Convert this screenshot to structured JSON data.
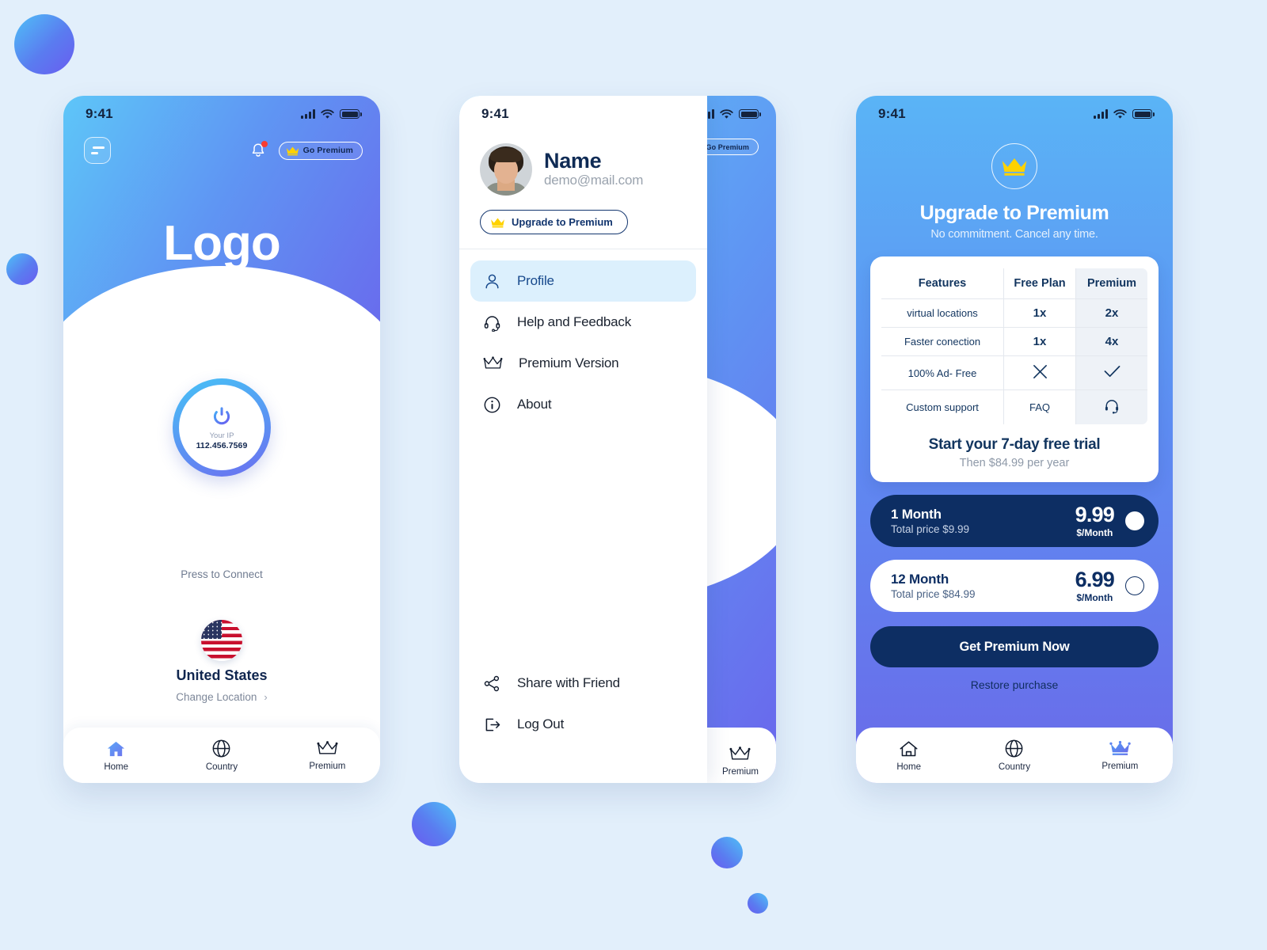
{
  "status_bar": {
    "time": "9:41"
  },
  "home_screen": {
    "menu_icon": "hamburger-menu-icon",
    "bell_icon": "notification-bell-icon",
    "go_premium_label": "Go Premium",
    "logo_text": "Logo",
    "connect": {
      "power_icon": "power-icon",
      "ip_label": "Your IP",
      "ip_value": "112.456.7569",
      "press_label": "Press to Connect"
    },
    "location": {
      "flag_icon": "united-states-flag-icon",
      "country": "United States",
      "change_label": "Change Location",
      "chevron": "›"
    },
    "tabs": [
      {
        "label": "Home",
        "icon": "home-icon",
        "active": true
      },
      {
        "label": "Country",
        "icon": "globe-icon",
        "active": false
      },
      {
        "label": "Premium",
        "icon": "crown-icon",
        "active": false
      }
    ]
  },
  "menu_screen": {
    "behind_go_premium_label": "Go Premium",
    "profile": {
      "avatar": "user-avatar",
      "name": "Name",
      "email": "demo@mail.com",
      "upgrade_label": "Upgrade to Premium",
      "crown_icon": "crown-icon"
    },
    "items": [
      {
        "label": "Profile",
        "icon": "person-icon",
        "selected": true
      },
      {
        "label": "Help and Feedback",
        "icon": "headset-icon",
        "selected": false
      },
      {
        "label": "Premium Version",
        "icon": "crown-icon",
        "selected": false
      },
      {
        "label": "About",
        "icon": "info-circle-icon",
        "selected": false
      }
    ],
    "bottom_items": [
      {
        "label": "Share with Friend",
        "icon": "share-icon"
      },
      {
        "label": "Log Out",
        "icon": "logout-icon"
      }
    ],
    "behind_tabs": [
      {
        "label": "Premium",
        "icon": "crown-icon"
      }
    ]
  },
  "premium_screen": {
    "crown_icon": "crown-icon",
    "title": "Upgrade to Premium",
    "subtitle": "No commitment. Cancel any time.",
    "table": {
      "headers": [
        "Features",
        "Free Plan",
        "Premium"
      ],
      "rows": [
        {
          "feature": "virtual locations",
          "free": "1x",
          "premium": "2x",
          "free_type": "text",
          "premium_type": "text"
        },
        {
          "feature": "Faster conection",
          "free": "1x",
          "premium": "4x",
          "free_type": "text",
          "premium_type": "text"
        },
        {
          "feature": "100% Ad- Free",
          "free": "",
          "premium": "",
          "free_type": "cross-icon",
          "premium_type": "check-icon"
        },
        {
          "feature": "Custom support",
          "free": "FAQ",
          "premium": "",
          "free_type": "text",
          "premium_type": "headset-icon"
        }
      ]
    },
    "trial_title": "Start your 7-day free trial",
    "trial_sub": "Then $84.99 per year",
    "plans": [
      {
        "title": "1 Month",
        "total": "Total price $9.99",
        "price": "9.99",
        "unit": "$/Month",
        "selected": true
      },
      {
        "title": "12 Month",
        "total": "Total price $84.99",
        "price": "6.99",
        "unit": "$/Month",
        "selected": false
      }
    ],
    "cta_label": "Get Premium Now",
    "restore_label": "Restore purchase",
    "tabs": [
      {
        "label": "Home",
        "icon": "home-icon",
        "active": false
      },
      {
        "label": "Country",
        "icon": "globe-icon",
        "active": false
      },
      {
        "label": "Premium",
        "icon": "crown-icon",
        "active": true
      }
    ]
  },
  "colors": {
    "background": "#e2effb",
    "gradient_start": "#5ec6f8",
    "gradient_end": "#6a66ec",
    "navy": "#0d2e63",
    "gold": "#ffd200",
    "accent_light": "#dcf0fd"
  }
}
